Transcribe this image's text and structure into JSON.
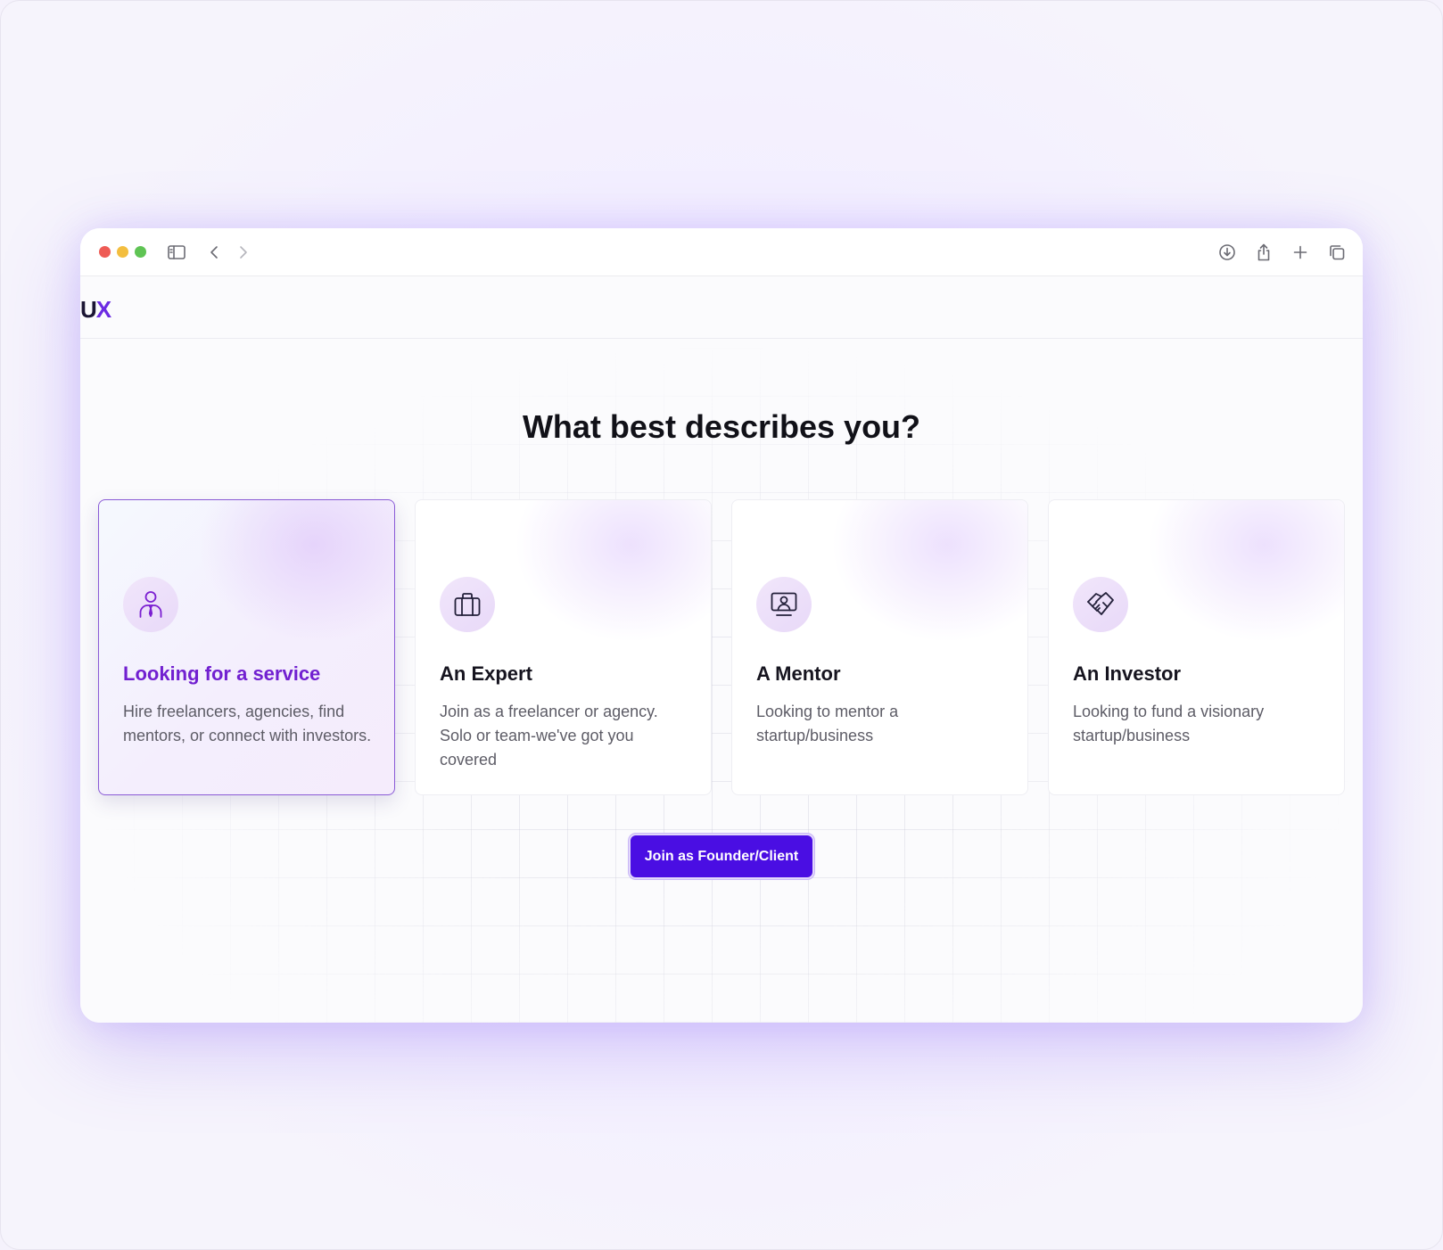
{
  "brand": {
    "logo_text_main": "U",
    "logo_text_accent": "X"
  },
  "browser": {
    "icons": [
      "sidebar-icon",
      "back-icon",
      "forward-icon",
      "download-icon",
      "share-icon",
      "new-tab-icon",
      "tabs-overview-icon"
    ]
  },
  "main": {
    "heading": "What best describes you?",
    "cards": [
      {
        "title": "Looking for a service",
        "description": "Hire freelancers, agencies, find mentors, or connect with investors.",
        "icon": "person-tie-icon",
        "selected": true
      },
      {
        "title": "An Expert",
        "description": "Join as a freelancer or agency. Solo or team-we've got you covered",
        "icon": "briefcase-icon",
        "selected": false
      },
      {
        "title": "A Mentor",
        "description": "Looking to mentor a startup/business",
        "icon": "presenter-screen-icon",
        "selected": false
      },
      {
        "title": "An Investor",
        "description": "Looking to fund a visionary startup/business",
        "icon": "handshake-icon",
        "selected": false
      }
    ],
    "join_button": "Join as Founder/Client"
  },
  "colors": {
    "accent": "#4a0ee3",
    "selected_title": "#7120d0",
    "selected_border": "#8a5bd6"
  }
}
